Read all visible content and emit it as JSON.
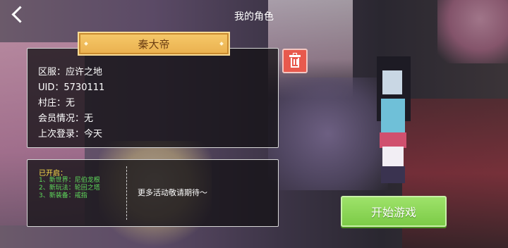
{
  "header": {
    "title": "我的角色"
  },
  "character": {
    "name": "秦大帝"
  },
  "info": [
    {
      "key": "区服：",
      "value": "应许之地"
    },
    {
      "key": "UID：",
      "value": "5730111"
    },
    {
      "key": "村庄：",
      "value": "无"
    },
    {
      "key": "会员情况：",
      "value": "无"
    },
    {
      "key": "上次登录：",
      "value": "今天"
    }
  ],
  "features": {
    "title": "已开启：",
    "items": [
      "1、新世界：尼伯龙根",
      "2、新玩法：轮回之塔",
      "3、新装备：戒指"
    ],
    "more": "更多活动敬请期待～"
  },
  "start_button": {
    "label": "开始游戏"
  },
  "icons": {
    "back": "back-arrow-icon",
    "delete": "trash-icon"
  },
  "colors": {
    "accent_green": "#8fd85a",
    "banner": "#f0bd5c",
    "delete": "#e8594d",
    "feature_title": "#ffe24a",
    "feature_item": "#5fdb5c"
  }
}
